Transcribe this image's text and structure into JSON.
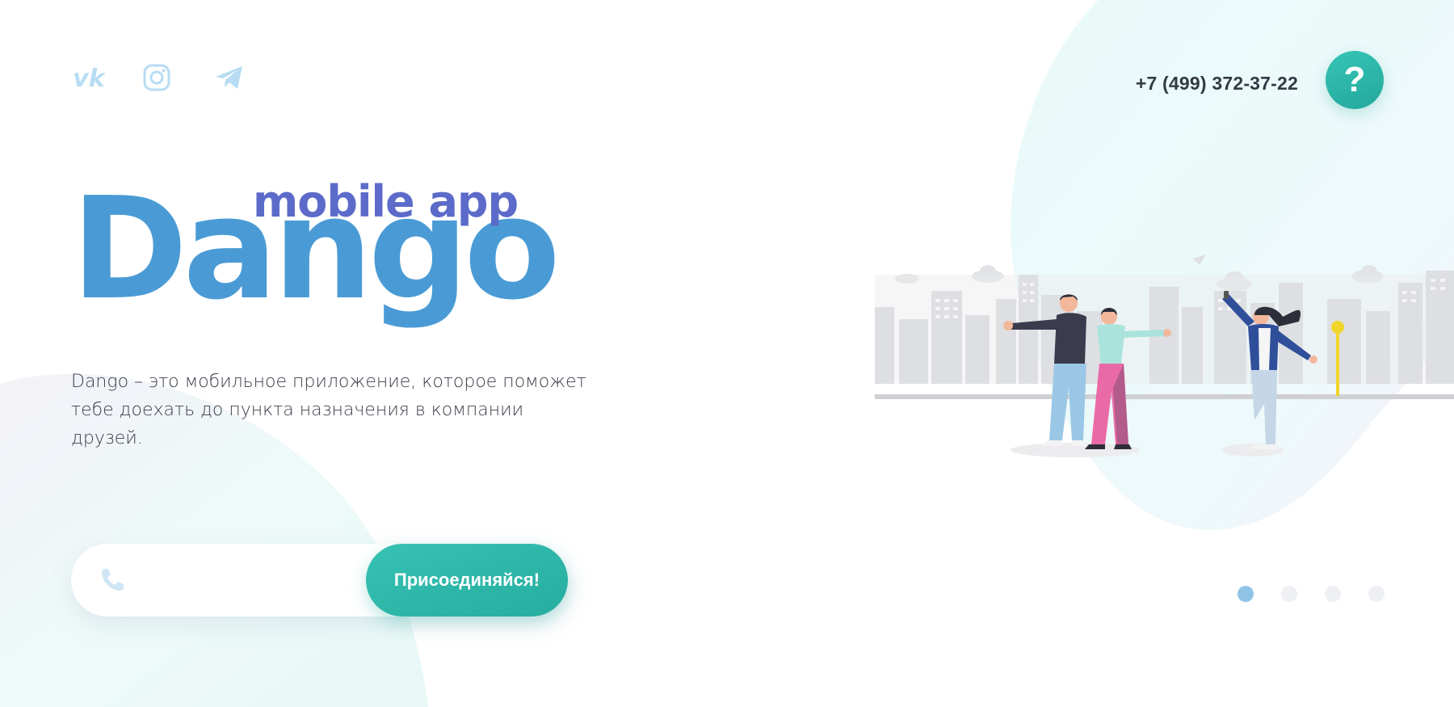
{
  "social": {
    "items": [
      {
        "name": "vk-icon"
      },
      {
        "name": "instagram-icon"
      },
      {
        "name": "telegram-icon"
      }
    ]
  },
  "header": {
    "phone": "+7 (499) 372-37-22",
    "help_label": "?"
  },
  "hero": {
    "logo_main": "Dango",
    "logo_sub": "mobile app",
    "description": "Dango – это мобильное приложение, которое поможет тебе доехать до пункта назначения в компании друзей."
  },
  "signup": {
    "phone_value": "",
    "phone_placeholder": "",
    "button_label": "Присоединяйся!"
  },
  "slider": {
    "count": 4,
    "active": 0
  },
  "colors": {
    "accent_teal": "#2bb5a8",
    "logo_blue": "#4a9bd5",
    "logo_purple": "#5c6bc9",
    "dot_active": "#8fc3e6"
  }
}
